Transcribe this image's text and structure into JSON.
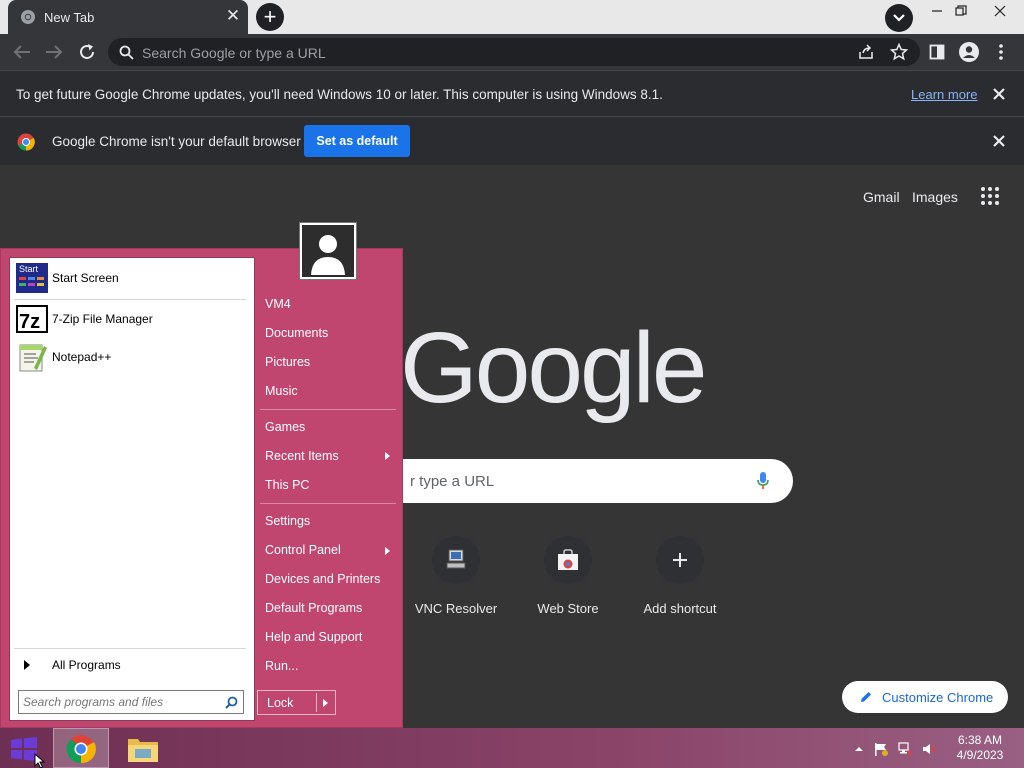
{
  "browser": {
    "tab_title": "New Tab",
    "tab_close": "✕",
    "new_tab": "+",
    "omnibox_placeholder": "Search Google or type a URL"
  },
  "infobar_update": {
    "text": "To get future Google Chrome updates, you'll need Windows 10 or later. This computer is using Windows 8.1.",
    "link": "Learn more"
  },
  "infobar_default": {
    "text": "Google Chrome isn't your default browser",
    "button": "Set as default"
  },
  "ntp": {
    "gmail": "Gmail",
    "images": "Images",
    "logo": "Google",
    "search_placeholder": "Search Google or type a URL",
    "search_visible_text": "r type a URL",
    "shortcuts": [
      {
        "label": "VNC Resolver",
        "icon": "vnc-icon"
      },
      {
        "label": "Web Store",
        "icon": "web-store-icon"
      },
      {
        "label": "Add shortcut",
        "icon": "plus-icon"
      }
    ],
    "customize": "Customize Chrome"
  },
  "start_menu": {
    "pinned": [
      {
        "label": "Start Screen",
        "icon": "start-screen-icon"
      },
      {
        "label": "7-Zip File Manager",
        "icon": "7zip-icon"
      },
      {
        "label": "Notepad++",
        "icon": "notepadpp-icon"
      }
    ],
    "all_programs": "All Programs",
    "search_placeholder": "Search programs and files",
    "right": {
      "user": "VM4",
      "documents": "Documents",
      "pictures": "Pictures",
      "music": "Music",
      "games": "Games",
      "recent": "Recent Items",
      "this_pc": "This PC",
      "settings": "Settings",
      "control_panel": "Control Panel",
      "devices": "Devices and Printers",
      "default_programs": "Default Programs",
      "help": "Help and Support",
      "run": "Run..."
    },
    "lock": "Lock",
    "start_screen_icon_text": "Start",
    "zip_icon_text": "7z"
  },
  "taskbar": {
    "time": "6:38 AM",
    "date": "4/9/2023"
  },
  "colors": {
    "start_menu_bg": "#c0466f",
    "chrome_dark": "#35363a",
    "accent_blue": "#1a73e8"
  }
}
